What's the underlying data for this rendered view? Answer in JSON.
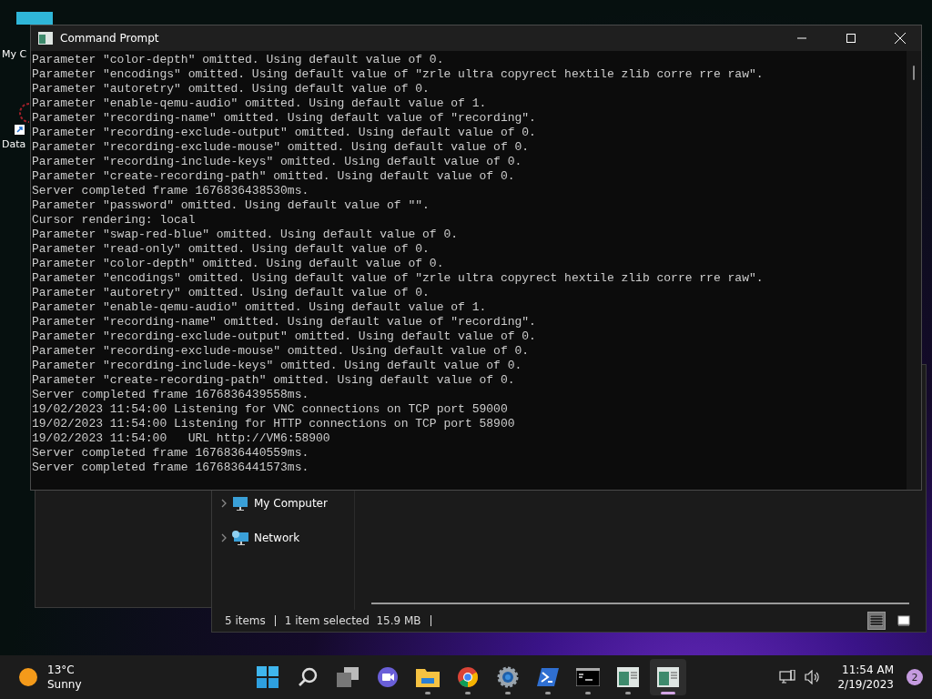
{
  "desktop_icons": [
    {
      "label": "My C",
      "kind": "computer"
    },
    {
      "label": "Data",
      "kind": "shortcut"
    }
  ],
  "console": {
    "title": "Command Prompt",
    "lines": [
      "Parameter \"color-depth\" omitted. Using default value of 0.",
      "Parameter \"encodings\" omitted. Using default value of \"zrle ultra copyrect hextile zlib corre rre raw\".",
      "Parameter \"autoretry\" omitted. Using default value of 0.",
      "Parameter \"enable-qemu-audio\" omitted. Using default value of 1.",
      "Parameter \"recording-name\" omitted. Using default value of \"recording\".",
      "Parameter \"recording-exclude-output\" omitted. Using default value of 0.",
      "Parameter \"recording-exclude-mouse\" omitted. Using default value of 0.",
      "Parameter \"recording-include-keys\" omitted. Using default value of 0.",
      "Parameter \"create-recording-path\" omitted. Using default value of 0.",
      "Server completed frame 1676836438530ms.",
      "Parameter \"password\" omitted. Using default value of \"\".",
      "Cursor rendering: local",
      "Parameter \"swap-red-blue\" omitted. Using default value of 0.",
      "Parameter \"read-only\" omitted. Using default value of 0.",
      "Parameter \"color-depth\" omitted. Using default value of 0.",
      "Parameter \"encodings\" omitted. Using default value of \"zrle ultra copyrect hextile zlib corre rre raw\".",
      "Parameter \"autoretry\" omitted. Using default value of 0.",
      "Parameter \"enable-qemu-audio\" omitted. Using default value of 1.",
      "Parameter \"recording-name\" omitted. Using default value of \"recording\".",
      "Parameter \"recording-exclude-output\" omitted. Using default value of 0.",
      "Parameter \"recording-exclude-mouse\" omitted. Using default value of 0.",
      "Parameter \"recording-include-keys\" omitted. Using default value of 0.",
      "Parameter \"create-recording-path\" omitted. Using default value of 0.",
      "Server completed frame 1676836439558ms.",
      "19/02/2023 11:54:00 Listening for VNC connections on TCP port 59000",
      "19/02/2023 11:54:00 Listening for HTTP connections on TCP port 58900",
      "19/02/2023 11:54:00   URL http://VM6:58900",
      "Server completed frame 1676836440559ms.",
      "Server completed frame 1676836441573ms."
    ]
  },
  "explorer": {
    "nav_items": [
      {
        "label": "My Computer",
        "kind": "computer"
      },
      {
        "label": "Network",
        "kind": "network"
      }
    ],
    "status_bar": {
      "items": "5 items",
      "selection": "1 item selected  15.9 MB"
    },
    "views": [
      {
        "kind": "details",
        "selected": true
      },
      {
        "kind": "tiles",
        "selected": false
      }
    ]
  },
  "taskbar": {
    "weather": {
      "temperature": "13°C",
      "condition": "Sunny"
    },
    "apps": [
      {
        "kind": "start",
        "running": false,
        "selected": false
      },
      {
        "kind": "search",
        "running": false,
        "selected": false
      },
      {
        "kind": "taskview",
        "running": false,
        "selected": false
      },
      {
        "kind": "chat",
        "running": false,
        "selected": false
      },
      {
        "kind": "folder",
        "running": true,
        "selected": false
      },
      {
        "kind": "browser",
        "running": true,
        "selected": false
      },
      {
        "kind": "settings",
        "running": true,
        "selected": false
      },
      {
        "kind": "powershell",
        "running": true,
        "selected": false
      },
      {
        "kind": "terminal",
        "running": true,
        "selected": false
      },
      {
        "kind": "window",
        "running": true,
        "selected": false
      },
      {
        "kind": "window",
        "running": true,
        "selected": true
      }
    ],
    "time": "11:54 AM",
    "date": "2/19/2023",
    "notifications": "2"
  }
}
